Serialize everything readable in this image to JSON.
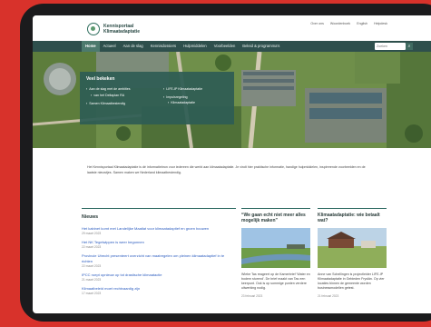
{
  "header": {
    "logo_line1": "Kennisportaal",
    "logo_line2": "Klimaatadaptatie",
    "top_links": [
      "Over ons",
      "Woordenboek",
      "English",
      "Helpdesk"
    ]
  },
  "nav": {
    "items": [
      "Home",
      "Actueel",
      "Aan de slag",
      "Kennisdossiers",
      "Hulpmiddelen",
      "Voorbeelden",
      "Beleid & programma's"
    ],
    "active": "Home",
    "search_placeholder": "Zoeken",
    "search_button_icon": "search-icon"
  },
  "hero": {
    "quick_title": "Veel bekeken",
    "links": [
      "Aan de slag met de ambities",
      "van het Deltaplan RA",
      "Samen Klimaatbestendig",
      "LIFE-IP Klimaatadaptatie",
      "Impulsregeling",
      "Klimaatadaptatie"
    ]
  },
  "intro": {
    "text": "Het Kennisportaal Klimaatadaptatie is dé informatiebron voor iedereen die werkt aan klimaatadaptatie. Je vindt hier praktische informatie, handige hulpmiddelen, inspirerende voorbeelden en de laatste nieuwtjes. Samen maken we Nederland klimaatbestendig."
  },
  "news": {
    "title": "Nieuws",
    "items": [
      {
        "title": "Het kabinet komt met Landelijke Maatlat voor klimaatadaptief en groen bouwen",
        "date": "29 maart 2023"
      },
      {
        "title": "Het NK Tegelwippen is weer begonnen",
        "date": "22 maart 2023"
      },
      {
        "title": "Provincie Utrecht presenteert overzicht van maatregelen om pleinen klimaatadaptief in te richten",
        "date": "22 maart 2023"
      },
      {
        "title": "IPCC roept opnieuw op tot drastische klimaatactie",
        "date": "21 maart 2023"
      },
      {
        "title": "Klimaatbeleid moet rechtvaardig zijn",
        "date": "17 maart 2023"
      }
    ]
  },
  "card1": {
    "title": "“We gaan echt niet meer alles mogelijk maken”",
    "text": "Wiebe Tas reageert op de Kamerbrief 'Water en bodem sturend'. De brief maakt van Tas een keerpunt. Ook is op sommige punten verdere uitwerking nodig.",
    "date": "23 februari 2023"
  },
  "card2": {
    "title": "Klimaatadaptatie: wie betaalt wat?",
    "text": "Anne van Schellingen is projectleider LIFE-IP Klimaatadaptatie in Gebieden Fryslân. Op vier locaties binnen de gemeente worden businessmodellen getest.",
    "date": "21 februari 2023"
  },
  "colors": {
    "brand_dark": "#2e4f4c",
    "accent": "#4c7a6d",
    "link": "#2a5bbf",
    "background": "#d8322b"
  }
}
